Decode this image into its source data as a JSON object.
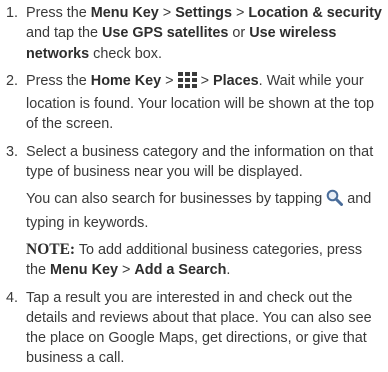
{
  "steps": [
    {
      "number": "1.",
      "segments": [
        "Press the ",
        "Menu Key",
        " > ",
        "Settings",
        " > ",
        "Location & security",
        " and tap the ",
        "Use GPS satellites",
        " or ",
        "Use wireless networks",
        " check box."
      ]
    },
    {
      "number": "2.",
      "segments": [
        "Press the ",
        "Home Key",
        " > ",
        " > ",
        "Places",
        ". Wait while your location is found. Your location will be shown at the top of the screen."
      ],
      "icon": "apps-grid-icon"
    },
    {
      "number": "3.",
      "main": "Select a business category and the information on that type of business near you will be displayed.",
      "search_note": [
        "You can also search for businesses by tapping ",
        " and typing in keywords."
      ],
      "search_icon": "search-icon",
      "note": {
        "label": "NOTE:",
        "segments": [
          " To add additional business categories, press the ",
          "Menu Key",
          " > ",
          "Add a Search",
          "."
        ]
      }
    },
    {
      "number": "4.",
      "main": "Tap a result you are interested in and check out the details and reviews about that place. You can also see the place on Google Maps, get directions, or give that business a call."
    }
  ],
  "colors": {
    "text": "#3a3a3a",
    "icon_grid": "#3b3b3b",
    "icon_search": "#4a6d9a"
  }
}
